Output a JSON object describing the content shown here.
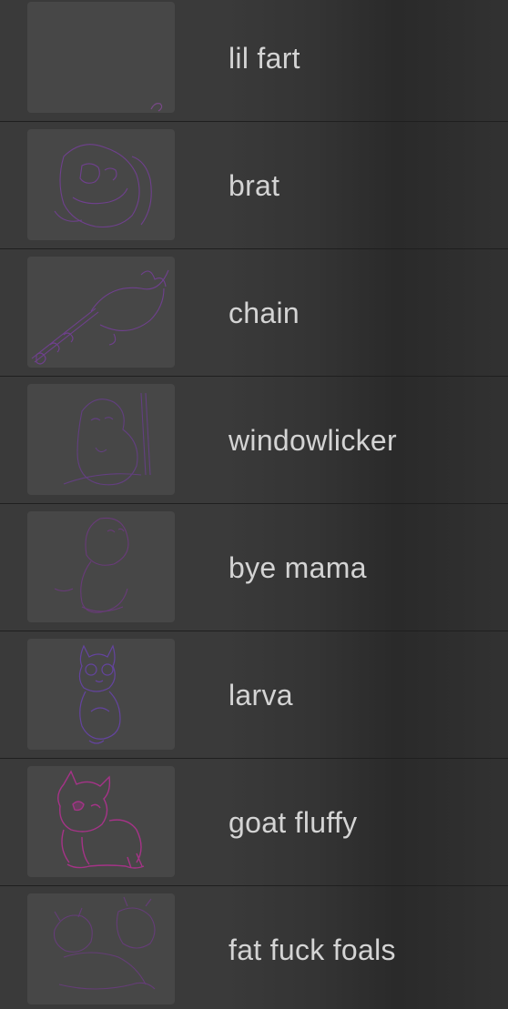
{
  "gallery": {
    "items": [
      {
        "title": "lil fart",
        "thumbnail_icon": "empty-sketch-thumbnail",
        "stroke_color": "#9b4fb0"
      },
      {
        "title": "brat",
        "thumbnail_icon": "sketch-thumbnail",
        "stroke_color": "#7a3fa0"
      },
      {
        "title": "chain",
        "thumbnail_icon": "sketch-thumbnail",
        "stroke_color": "#7a3fa0"
      },
      {
        "title": "windowlicker",
        "thumbnail_icon": "sketch-thumbnail",
        "stroke_color": "#6a3e8f"
      },
      {
        "title": "bye mama",
        "thumbnail_icon": "sketch-thumbnail",
        "stroke_color": "#74378a"
      },
      {
        "title": "larva",
        "thumbnail_icon": "sketch-thumbnail",
        "stroke_color": "#6a44b0"
      },
      {
        "title": "goat fluffy",
        "thumbnail_icon": "sketch-thumbnail",
        "stroke_color": "#b0318f"
      },
      {
        "title": "fat fuck foals",
        "thumbnail_icon": "sketch-thumbnail",
        "stroke_color": "#6f3a88"
      }
    ]
  }
}
